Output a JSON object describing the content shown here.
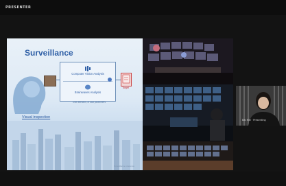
{
  "meeting": {
    "title": "PRESENTER"
  },
  "slide": {
    "title": "Surveillance",
    "box_items": [
      "Computer Vision Analysis",
      "Brainwaves Analysis"
    ],
    "box_caption": "User attention, or task parameters",
    "target_label": "Target",
    "link": "Visual inspection",
    "footnote": "Surveillance reference"
  },
  "participant": {
    "name": "Bai Mei · Presenting"
  },
  "colors": {
    "slide_title": "#2f5fa6",
    "target": "#cc3333",
    "background": "#131313"
  }
}
